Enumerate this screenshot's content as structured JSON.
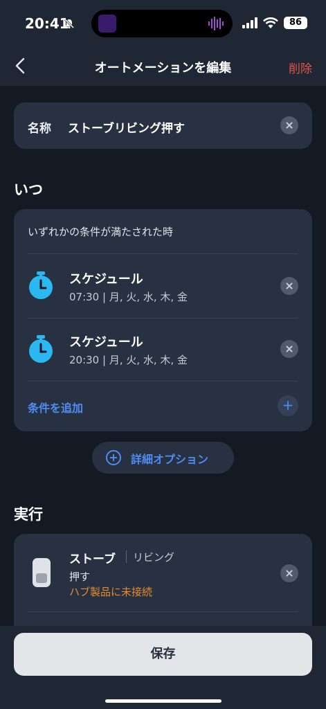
{
  "status_bar": {
    "time": "20:41",
    "battery": "86"
  },
  "nav": {
    "title": "オートメーションを編集",
    "delete_label": "削除"
  },
  "name_field": {
    "label": "名称",
    "value": "ストーブリビング押す"
  },
  "when": {
    "section_title": "いつ",
    "caption": "いずれかの条件が満たされた時",
    "schedules": [
      {
        "title": "スケジュール",
        "detail": "07:30 | 月, 火, 水, 木, 金"
      },
      {
        "title": "スケジュール",
        "detail": "20:30 | 月, 火, 水, 木, 金"
      }
    ],
    "add_condition_label": "条件を追加",
    "add_icon": "plus-icon"
  },
  "advanced_options_label": "詳細オプション",
  "execute": {
    "section_title": "実行",
    "device": {
      "name": "ストーブ",
      "room": "リビング",
      "action": "押す",
      "status": "ハブ製品に未接続"
    }
  },
  "save_label": "保存",
  "colors": {
    "accent": "#4f8df2",
    "danger": "#e0544c",
    "warning": "#e98a2c",
    "timer": "#2bb7f0"
  }
}
